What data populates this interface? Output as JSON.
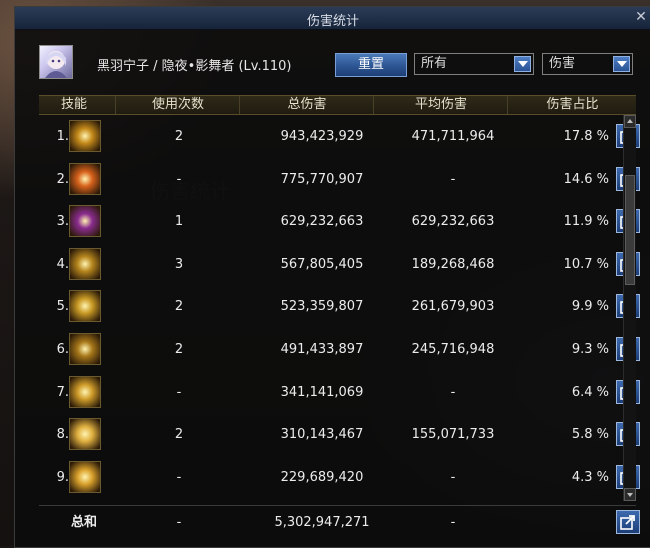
{
  "window": {
    "title": "伤害统计",
    "close_icon": "close-icon"
  },
  "character": {
    "name": "黑羽宁子 / 隐夜•影舞者 (Lv.110)"
  },
  "controls": {
    "reset_label": "重置",
    "filter_select": "所有",
    "mode_select": "伤害"
  },
  "table": {
    "headers": [
      "技能",
      "使用次数",
      "总伤害",
      "平均伤害",
      "伤害占比"
    ],
    "rows": [
      {
        "rank": "1.",
        "uses": "2",
        "total": "943,423,929",
        "avg": "471,711,964",
        "pct": "17.8 %",
        "icon_color": "#c58a1a"
      },
      {
        "rank": "2.",
        "uses": "-",
        "total": "775,770,907",
        "avg": "-",
        "pct": "14.6 %",
        "icon_color": "#d8621c"
      },
      {
        "rank": "3.",
        "uses": "1",
        "total": "629,232,663",
        "avg": "629,232,663",
        "pct": "11.9 %",
        "icon_color": "#8a2c8e"
      },
      {
        "rank": "4.",
        "uses": "3",
        "total": "567,805,405",
        "avg": "189,268,468",
        "pct": "10.7 %",
        "icon_color": "#b6861e"
      },
      {
        "rank": "5.",
        "uses": "2",
        "total": "523,359,807",
        "avg": "261,679,903",
        "pct": "9.9 %",
        "icon_color": "#c99a25"
      },
      {
        "rank": "6.",
        "uses": "2",
        "total": "491,433,897",
        "avg": "245,716,948",
        "pct": "9.3 %",
        "icon_color": "#a7781a"
      },
      {
        "rank": "7.",
        "uses": "-",
        "total": "341,141,069",
        "avg": "-",
        "pct": "6.4 %",
        "icon_color": "#cf9c2a"
      },
      {
        "rank": "8.",
        "uses": "2",
        "total": "310,143,467",
        "avg": "155,071,733",
        "pct": "5.8 %",
        "icon_color": "#e0b040"
      },
      {
        "rank": "9.",
        "uses": "-",
        "total": "229,689,420",
        "avg": "-",
        "pct": "4.3 %",
        "icon_color": "#d9a12c"
      }
    ],
    "summary": {
      "label": "总和",
      "uses": "-",
      "total": "5,302,947,271",
      "avg": "-"
    }
  },
  "colors": {
    "accent_blue": "#2d5593",
    "title_bar": "#1f2e47"
  }
}
